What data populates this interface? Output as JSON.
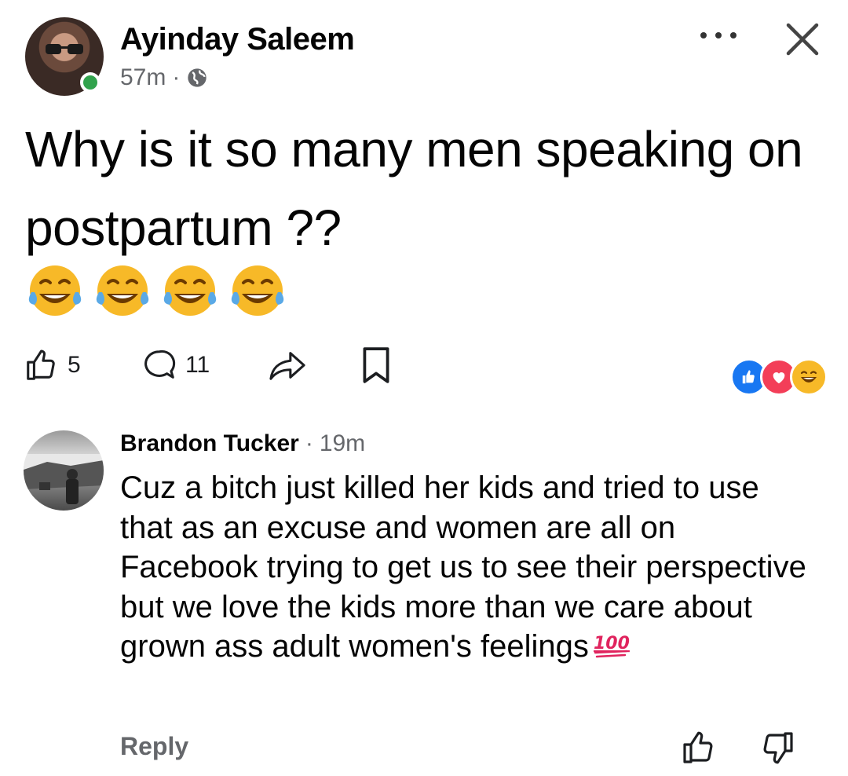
{
  "post": {
    "author": "Ayinday Saleem",
    "time": "57m",
    "separator": "·",
    "text": "Why is it so many men speaking on postpartum ??",
    "emojis": [
      "😂",
      "😂",
      "😂",
      "😂"
    ],
    "like_count": "5",
    "comment_count": "11",
    "reactions": [
      "like-icon",
      "love-icon",
      "haha-icon"
    ]
  },
  "comment": {
    "author": "Brandon Tucker",
    "separator": "·",
    "time": "19m",
    "text": "Cuz a bitch just killed her kids and tried to use that as an excuse and women are all on Facebook trying to get us to see their perspective but we love the kids more than we care about grown ass adult women's feelings",
    "reply_label": "Reply"
  },
  "colors": {
    "online": "#31a24c",
    "meta_gray": "#65676b",
    "like_blue": "#1877f2",
    "love_red": "#f33e58",
    "hundred_red": "#e0245e"
  }
}
